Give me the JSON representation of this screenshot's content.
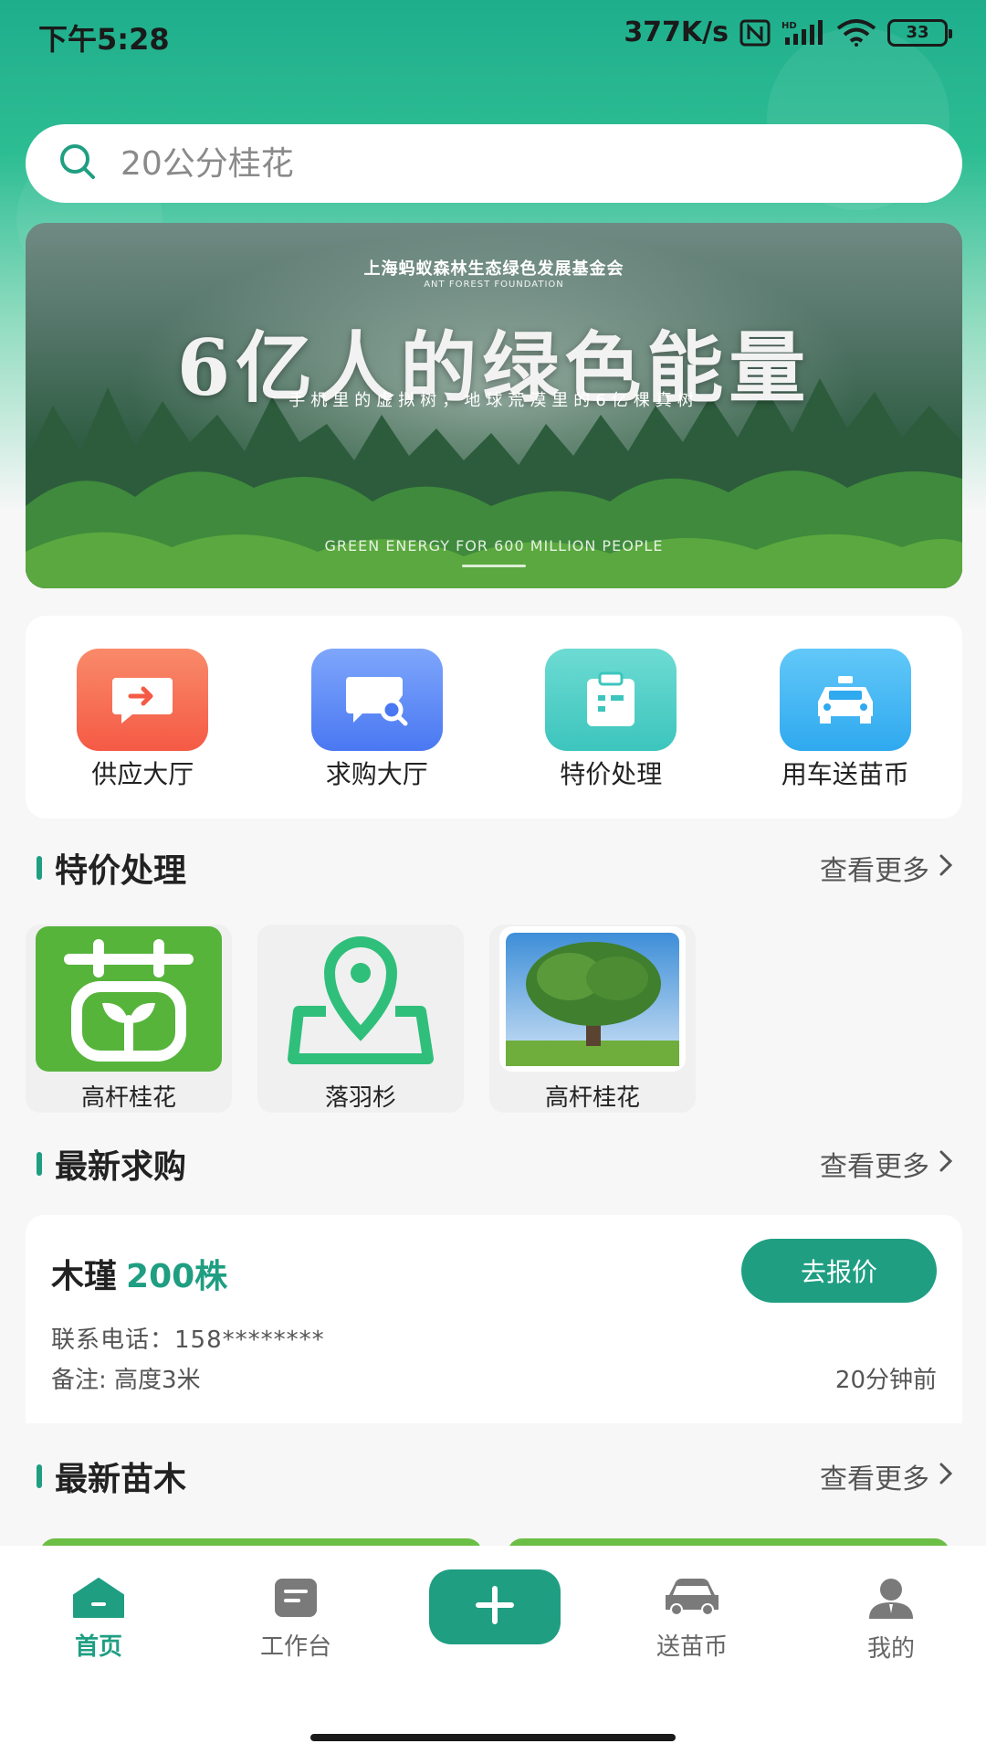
{
  "status_bar": {
    "time": "下午5:28",
    "net_speed": "377K/s",
    "battery": "33"
  },
  "search": {
    "placeholder": "20公分桂花"
  },
  "banner": {
    "org_name": "上海蚂蚁森林生态绿色发展基金会",
    "org_en": "ANT FOREST FOUNDATION",
    "title": "6亿人的绿色能量",
    "subtitle": "手机里的虚拟树，地球荒漠里的6亿棵真树",
    "en_caption": "GREEN ENERGY FOR 600 MILLION PEOPLE"
  },
  "quick_menu": [
    {
      "label": "供应大厅",
      "icon": "supply-hall-icon",
      "color": "#f8644c"
    },
    {
      "label": "求购大厅",
      "icon": "purchase-hall-icon",
      "color": "#5a86f5"
    },
    {
      "label": "特价处理",
      "icon": "special-offer-icon",
      "color": "#4fcfc6"
    },
    {
      "label": "用车送苗币",
      "icon": "car-icon",
      "color": "#3fb5f3"
    }
  ],
  "special_section": {
    "title": "特价处理",
    "more": "查看更多",
    "items": [
      {
        "name": "高杆桂花",
        "icon": "seedling-logo-icon"
      },
      {
        "name": "落羽杉",
        "icon": "map-pin-icon"
      },
      {
        "name": "高杆桂花",
        "icon": "tree-photo-icon"
      }
    ]
  },
  "purchase_section": {
    "title": "最新求购",
    "more": "查看更多",
    "card": {
      "plant": "木瑾",
      "quantity": "200株",
      "button": "去报价",
      "phone": "联系电话：158********",
      "note": "备注: 高度3米",
      "time": "20分钟前"
    }
  },
  "seedling_section": {
    "title": "最新苗木",
    "more": "查看更多"
  },
  "bottom_nav": {
    "home": "首页",
    "workbench": "工作台",
    "coins": "送苗币",
    "mine": "我的"
  },
  "colors": {
    "brand": "#1f9e82",
    "gradient_top": "#1fae8c"
  }
}
